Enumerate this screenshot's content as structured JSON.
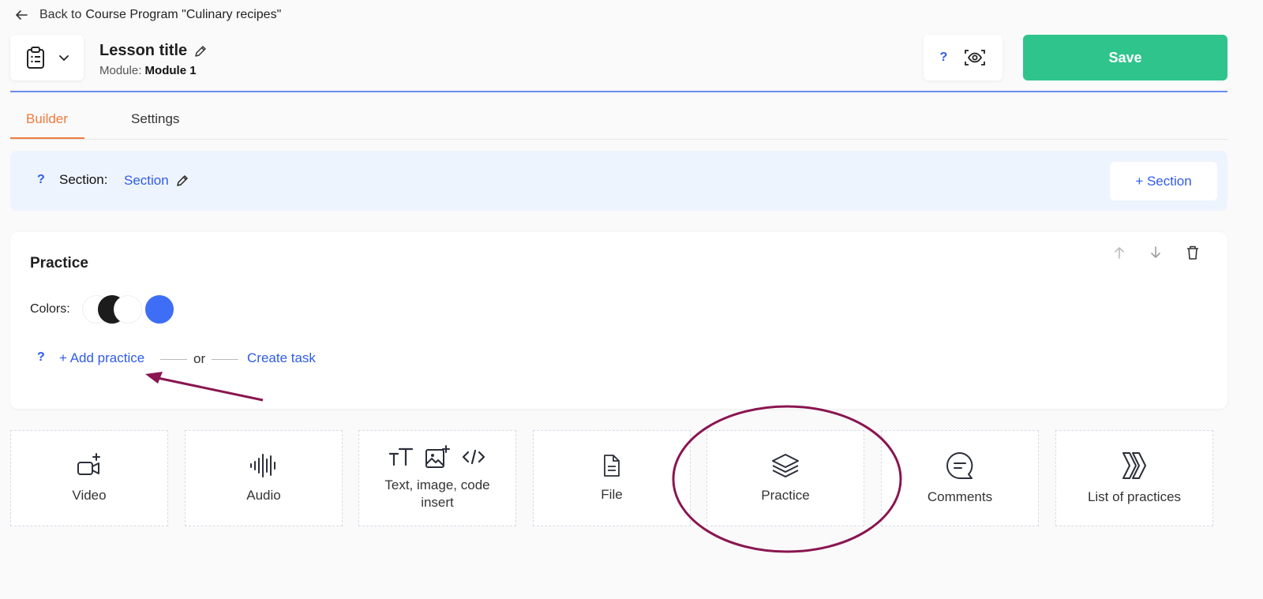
{
  "back": {
    "prefix": "Back to",
    "target": "Course Program \"Culinary recipes\""
  },
  "header": {
    "lesson_title": "Lesson title",
    "module_label": "Module:",
    "module_value": "Module 1",
    "help": "?",
    "save_label": "Save"
  },
  "tabs": [
    {
      "label": "Builder",
      "active": true
    },
    {
      "label": "Settings",
      "active": false
    }
  ],
  "section": {
    "help": "?",
    "label": "Section:",
    "value": "Section",
    "add_label": "+ Section"
  },
  "practice_card": {
    "title": "Practice",
    "colors_label": "Colors:",
    "colors": [
      "#ffffff",
      "#1c1c1c",
      "#ffffff",
      "#3e6ef5"
    ],
    "help": "?",
    "add_practice": "+ Add practice",
    "or": "or",
    "create_task": "Create task"
  },
  "blocks": [
    {
      "label": "Video",
      "icon": "video-add-icon"
    },
    {
      "label": "Audio",
      "icon": "audio-wave-icon"
    },
    {
      "label": "Text, image, code insert",
      "icon": "text-image-code-icon"
    },
    {
      "label": "File",
      "icon": "file-icon"
    },
    {
      "label": "Practice",
      "icon": "layers-icon"
    },
    {
      "label": "Comments",
      "icon": "comment-icon"
    },
    {
      "label": "List of practices",
      "icon": "list-practices-icon"
    }
  ],
  "colors": {
    "accent": "#2f5bea",
    "save": "#30c48d",
    "tab_active": "#ef7a3c",
    "annotation": "#8a1550"
  }
}
